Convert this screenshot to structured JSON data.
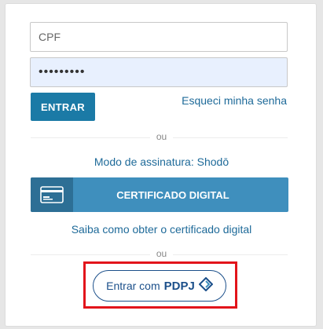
{
  "login": {
    "cpf_placeholder": "CPF",
    "password_value": "•••••••••",
    "submit_label": "ENTRAR",
    "forgot_password": "Esqueci minha senha"
  },
  "divider_text": "ou",
  "signature": {
    "mode_text": "Modo de assinatura: Shodō",
    "certificate_button": "CERTIFICADO DIGITAL",
    "certificate_help": "Saiba como obter o certificado digital"
  },
  "pdpj": {
    "prefix": "Entrar com",
    "brand": "PDPJ"
  },
  "colors": {
    "primary": "#1b7aa6",
    "certificate": "#3f8fbd",
    "link": "#1e6a99",
    "highlight": "#e2141b"
  }
}
